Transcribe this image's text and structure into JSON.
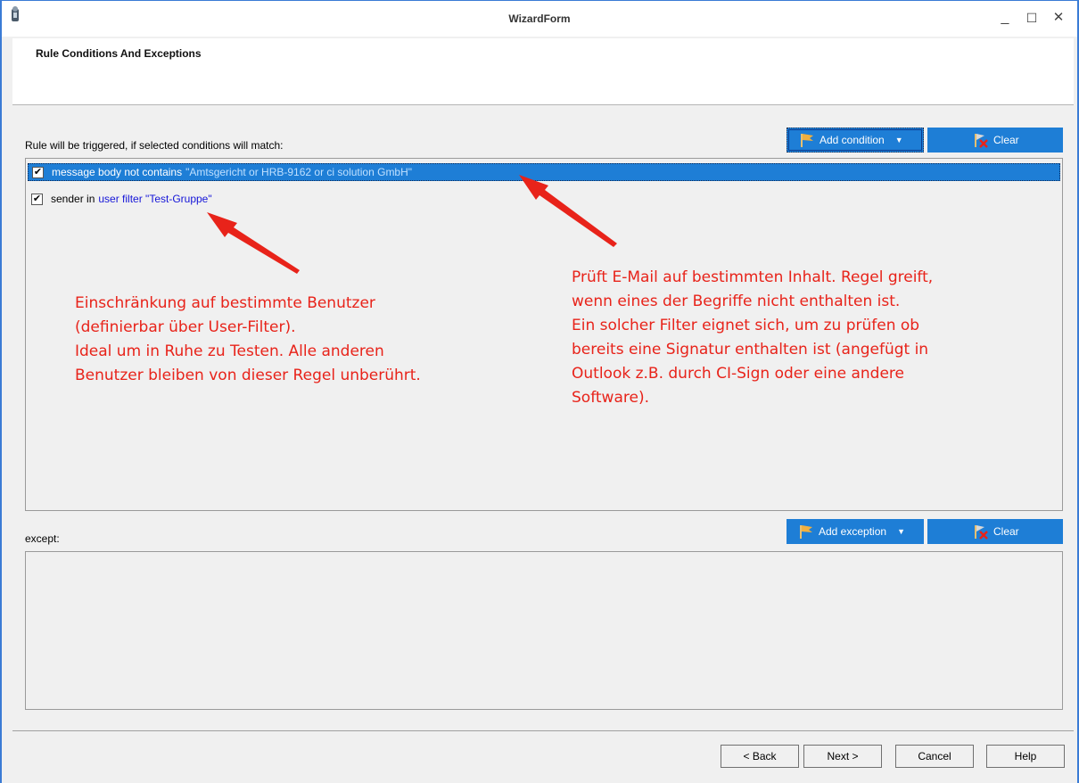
{
  "window": {
    "title": "WizardForm",
    "controls": {
      "minimize": "_",
      "maximize": "☐",
      "close": "✕"
    }
  },
  "header": {
    "title": "Rule Conditions And Exceptions"
  },
  "conditions": {
    "label": "Rule will be triggered, if selected conditions will match:",
    "add_button": "Add condition",
    "clear_button": "Clear",
    "items": [
      {
        "checked": true,
        "selected": true,
        "text": "message body not contains",
        "link": "\"Amtsgericht or HRB-9162 or ci solution GmbH\""
      },
      {
        "checked": true,
        "selected": false,
        "text": "sender in",
        "link": "user filter \"Test-Gruppe\""
      }
    ]
  },
  "exceptions": {
    "label": "except:",
    "add_button": "Add exception",
    "clear_button": "Clear"
  },
  "footer": {
    "back": "< Back",
    "next": "Next >",
    "cancel": "Cancel",
    "help": "Help"
  },
  "annotations": {
    "left": [
      "Einschränkung auf bestimmte Benutzer",
      "(definierbar über User-Filter).",
      "Ideal um in Ruhe zu Testen. Alle anderen",
      "Benutzer bleiben von dieser Regel unberührt."
    ],
    "right": [
      "Prüft E-Mail auf bestimmten Inhalt. Regel greift,",
      "wenn eines der Begriffe nicht enthalten ist.",
      "Ein solcher Filter eignet sich, um zu prüfen ob",
      "bereits eine Signatur enthalten ist (angefügt in",
      "Outlook z.B. durch CI-Sign oder eine andere",
      "Software)."
    ]
  },
  "colors": {
    "accent": "#1e7ed6",
    "annotation": "#e8231a",
    "link": "#1515d8"
  }
}
